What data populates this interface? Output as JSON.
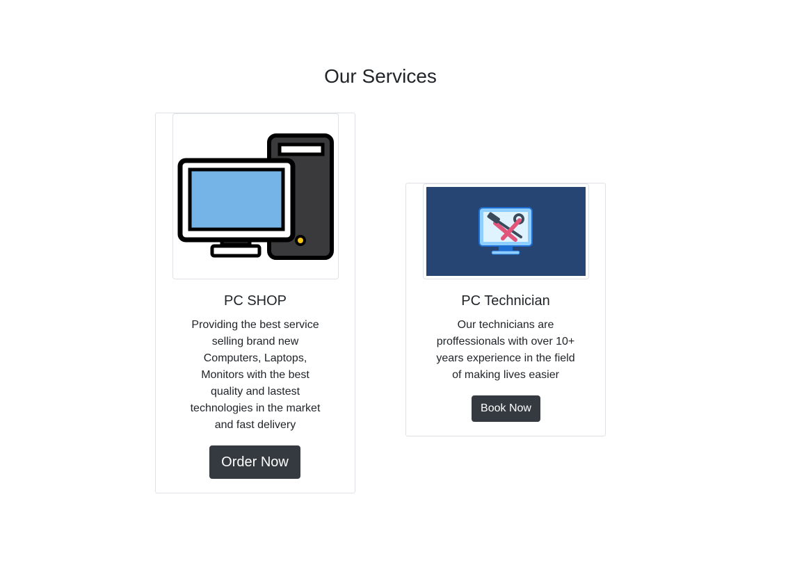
{
  "section": {
    "title": "Our Services"
  },
  "services": [
    {
      "title": "PC SHOP",
      "description": "Providing the best service selling brand new Computers, Laptops, Monitors with the best quality and lastest technologies in the market and fast delivery",
      "button_label": "Order Now",
      "icon": "desktop-computer-icon"
    },
    {
      "title": "PC Technician",
      "description": "Our technicians are proffessionals with over 10+ years experience in the field of making lives easier",
      "button_label": "Book Now",
      "icon": "repair-tools-monitor-icon"
    }
  ],
  "colors": {
    "button_bg": "#343a40",
    "card_border": "#dee2e6",
    "tech_thumb_bg": "#264573",
    "monitor_screen": "#74b4e6"
  }
}
